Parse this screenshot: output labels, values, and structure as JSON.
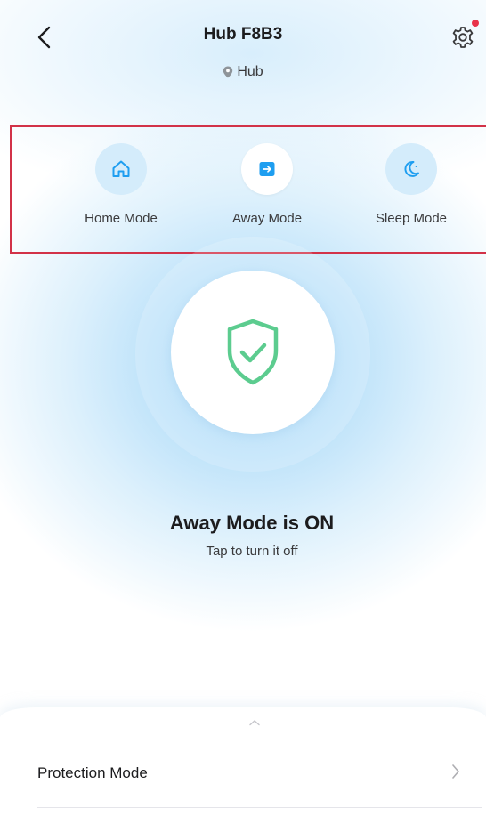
{
  "header": {
    "title": "Hub F8B3",
    "location": "Hub",
    "back_icon": "chevron-left-icon",
    "settings_icon": "gear-icon",
    "notification_dot_color": "#e8334a"
  },
  "modes": [
    {
      "label": "Home Mode",
      "icon": "home-icon",
      "active": false
    },
    {
      "label": "Away Mode",
      "icon": "away-exit-icon",
      "active": true
    },
    {
      "label": "Sleep Mode",
      "icon": "moon-icon",
      "active": false
    }
  ],
  "highlight_color": "#d23248",
  "accent_color": "#1e9ef0",
  "status": {
    "icon": "shield-check-icon",
    "shield_color": "#5ccc8f",
    "title": "Away Mode is ON",
    "subtitle": "Tap to turn it off"
  },
  "bottom_sheet": {
    "handle_icon": "chevron-up-icon",
    "rows": [
      {
        "label": "Protection Mode",
        "icon": "chevron-right-icon"
      }
    ]
  }
}
